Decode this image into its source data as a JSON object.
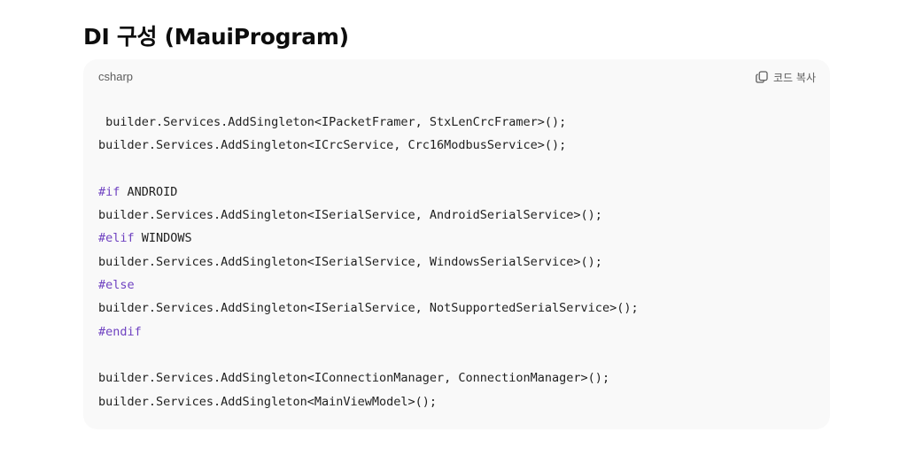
{
  "heading": "DI 구성 (MauiProgram)",
  "code_block": {
    "language": "csharp",
    "copy_label": "코드 복사",
    "copy_icon": "copy-icon",
    "keyword_color": "#6f42c1",
    "lines": [
      " builder.Services.AddSingleton<IPacketFramer, StxLenCrcFramer>();",
      "builder.Services.AddSingleton<ICrcService, Crc16ModbusService>();",
      "",
      "#if ANDROID",
      "builder.Services.AddSingleton<ISerialService, AndroidSerialService>();",
      "#elif WINDOWS",
      "builder.Services.AddSingleton<ISerialService, WindowsSerialService>();",
      "#else",
      "builder.Services.AddSingleton<ISerialService, NotSupportedSerialService>();",
      "#endif",
      "",
      "builder.Services.AddSingleton<IConnectionManager, ConnectionManager>();",
      "builder.Services.AddSingleton<MainViewModel>();"
    ]
  }
}
